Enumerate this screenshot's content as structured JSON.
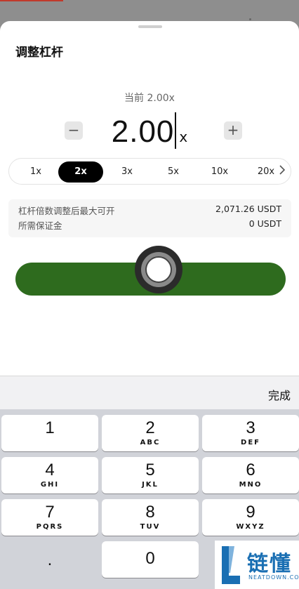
{
  "sheet": {
    "title": "调整杠杆",
    "current_label": "当前 2.00x",
    "leverage_value": "2.00",
    "leverage_unit": "x",
    "minus_label": "−",
    "plus_label": "+",
    "presets": [
      "1x",
      "2x",
      "3x",
      "5x",
      "10x",
      "20x"
    ],
    "selected_preset": "2x",
    "more_icon": "chevron-right-icon",
    "info": {
      "max_open_label": "杠杆倍数调整后最大可开",
      "max_open_value": "2,071.26 USDT",
      "margin_label": "所需保证金",
      "margin_value": "0 USDT"
    },
    "confirm_color": "#2e6b1e"
  },
  "keyboard": {
    "done_label": "完成",
    "keys": [
      {
        "num": "1",
        "letters": ""
      },
      {
        "num": "2",
        "letters": "ABC"
      },
      {
        "num": "3",
        "letters": "DEF"
      },
      {
        "num": "4",
        "letters": "GHI"
      },
      {
        "num": "5",
        "letters": "JKL"
      },
      {
        "num": "6",
        "letters": "MNO"
      },
      {
        "num": "7",
        "letters": "PQRS"
      },
      {
        "num": "8",
        "letters": "TUV"
      },
      {
        "num": "9",
        "letters": "WXYZ"
      },
      {
        "num": ".",
        "letters": ""
      },
      {
        "num": "0",
        "letters": ""
      }
    ]
  },
  "watermark": {
    "name": "链懂",
    "sub": "NEATDOWN.COM"
  }
}
